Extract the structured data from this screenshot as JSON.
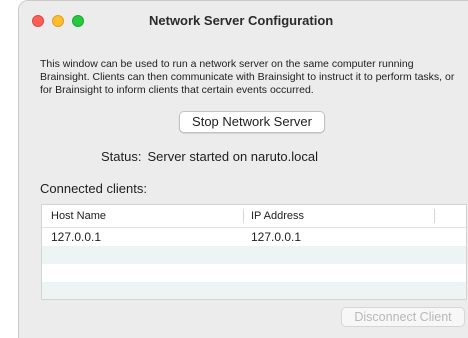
{
  "window": {
    "title": "Network Server Configuration",
    "controls": {
      "close_color": "#fe5f57",
      "minimize_color": "#febc2e",
      "maximize_color": "#28c840"
    }
  },
  "description": "This window can be used to run a network server on the same computer running Brainsight. Clients can then communicate with Brainsight to instruct it to perform tasks, or for Brainsight to inform clients that certain events occurred.",
  "server_button_label": "Stop Network Server",
  "status": {
    "label": "Status:",
    "value": "Server started on naruto.local"
  },
  "clients": {
    "label": "Connected clients:",
    "columns": [
      "Host Name",
      "IP Address"
    ],
    "rows": [
      {
        "host": "127.0.0.1",
        "ip": "127.0.0.1"
      },
      {
        "host": "",
        "ip": ""
      },
      {
        "host": "",
        "ip": ""
      },
      {
        "host": "",
        "ip": ""
      }
    ]
  },
  "disconnect_button_label": "Disconnect Client"
}
